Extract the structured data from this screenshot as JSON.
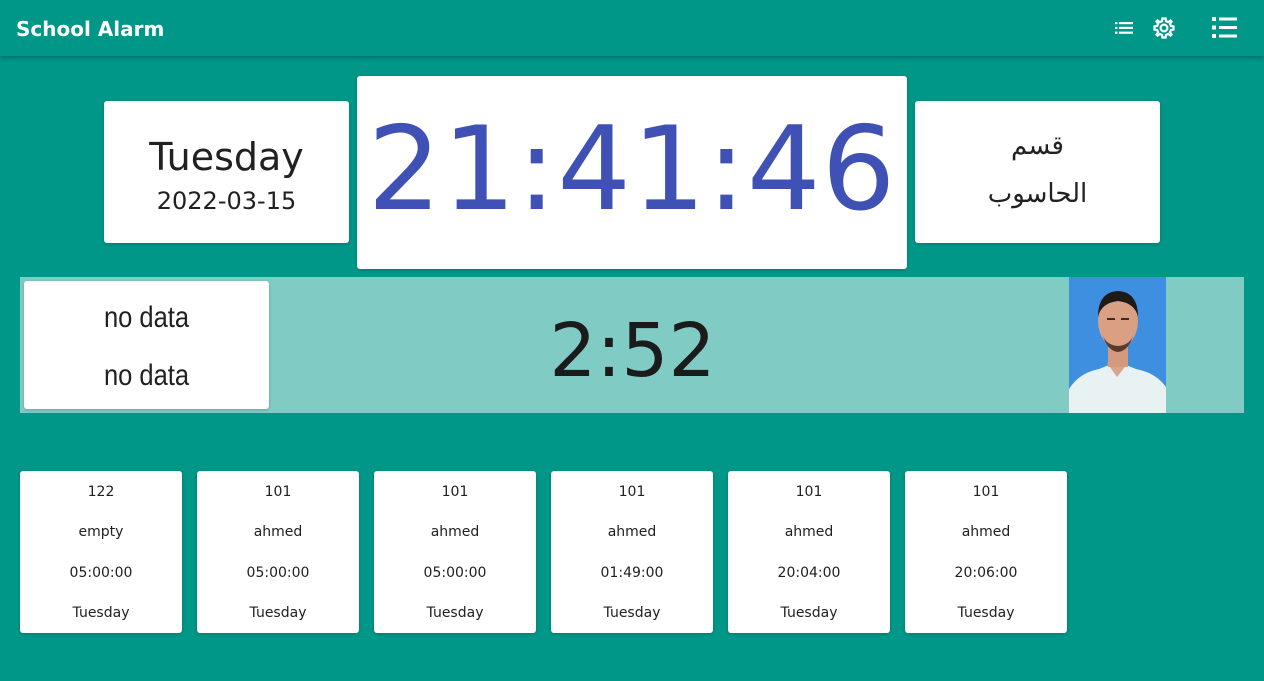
{
  "app": {
    "title": "School Alarm",
    "icons": [
      "list-icon",
      "gear-icon",
      "menu-list-icon"
    ]
  },
  "date_card": {
    "day": "Tuesday",
    "date": "2022-03-15"
  },
  "clock": {
    "time": "21:41:46"
  },
  "department": {
    "line1": "قسم",
    "line2": "الحاسوب"
  },
  "current": {
    "line1": "no data",
    "line2": "no data",
    "countdown": "2:52"
  },
  "schedule": [
    {
      "number": "122",
      "name": "empty",
      "time": "05:00:00",
      "day": "Tuesday"
    },
    {
      "number": "101",
      "name": "ahmed",
      "time": "05:00:00",
      "day": "Tuesday"
    },
    {
      "number": "101",
      "name": "ahmed",
      "time": "05:00:00",
      "day": "Tuesday"
    },
    {
      "number": "101",
      "name": "ahmed",
      "time": "01:49:00",
      "day": "Tuesday"
    },
    {
      "number": "101",
      "name": "ahmed",
      "time": "20:04:00",
      "day": "Tuesday"
    },
    {
      "number": "101",
      "name": "ahmed",
      "time": "20:06:00",
      "day": "Tuesday"
    }
  ],
  "colors": {
    "background": "#009688",
    "band": "#80cbc4",
    "clock_text": "#3f51b5",
    "card": "#ffffff"
  }
}
